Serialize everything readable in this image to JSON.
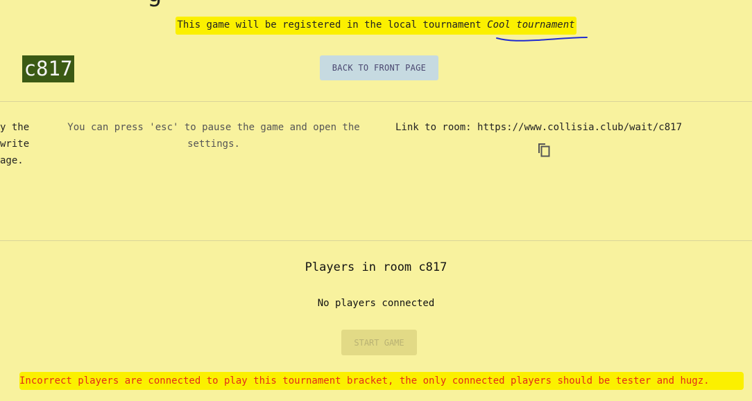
{
  "page": {
    "title_fragment": "g"
  },
  "tournament": {
    "prefix": "This game will be registered in the local tournament",
    "name": "Cool tournament"
  },
  "room": {
    "code": "c817"
  },
  "buttons": {
    "back_label": "BACK TO FRONT PAGE",
    "start_label": "START GAME"
  },
  "info": {
    "left_lines": [
      "y the",
      "write",
      "age."
    ],
    "middle_text": "You can press 'esc' to pause the game and open the settings.",
    "link_label": "Link to room:",
    "link_url": "https://www.collisia.club/wait/c817"
  },
  "players": {
    "title": "Players in room c817",
    "empty_text": "No players connected"
  },
  "error": {
    "message": "Incorrect players are connected to play this tournament bracket, the only connected players should be tester and hugz."
  },
  "colors": {
    "background": "#f8f29e",
    "highlight": "#fbf000",
    "room_badge": "#3b5a14",
    "back_button": "#c6dae1",
    "error_text": "#e22b1a"
  },
  "icons": {
    "copy": "copy-icon"
  }
}
